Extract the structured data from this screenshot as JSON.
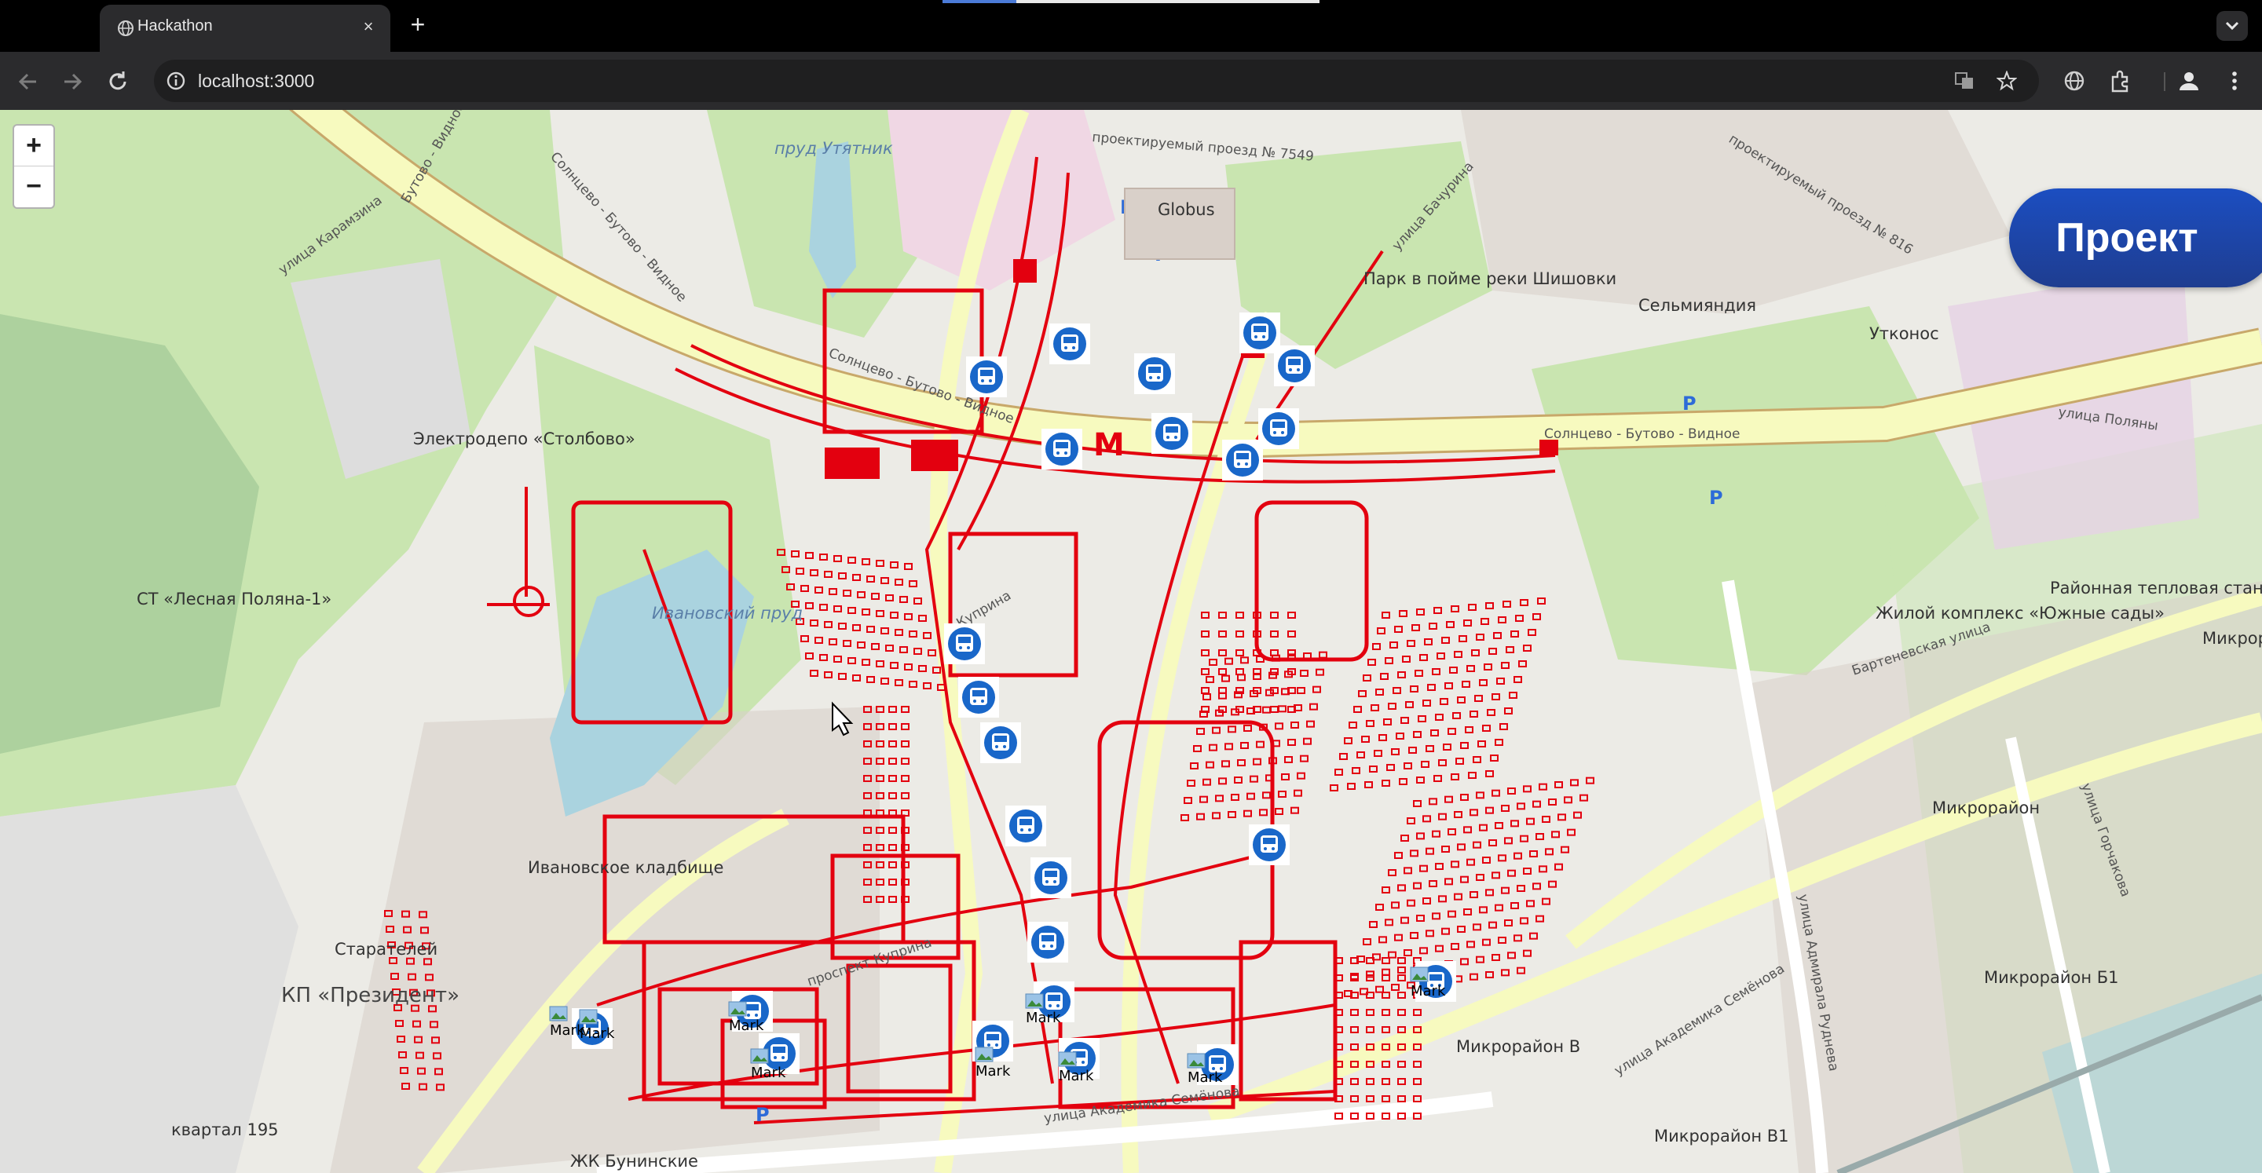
{
  "browser": {
    "tab_title": "Hackathon",
    "tab_close": "×",
    "new_tab": "+",
    "url": "localhost:3000"
  },
  "map": {
    "zoom_in": "+",
    "zoom_out": "−",
    "project_button": "Проект",
    "marker_label": "Mark",
    "labels": {
      "solntsevo_butovo_vidnoe": "Солнцево - Бутово - Видное",
      "butovo_vidnoe": "Бутово - Видное",
      "prud_utyatnik": "пруд Утятник",
      "proezd_7549": "проектируемый проезд № 7549",
      "globus": "Globus",
      "ulitsa_kupriyana": "Куприна",
      "park_shishovki": "Парк в пойме реки Шишовки",
      "ulitsa_zdanie_gruppa": "улица Бачурина",
      "selmilandiya": "Сельмияндия",
      "proezd_816": "проектируемый проезд № 816",
      "utkonos": "Утконос",
      "ulitsa_karamzina": "улица Карамзина",
      "elektrodepo": "Электродепо «Столбово»",
      "ivanovsky_prud": "Ивановский пруд",
      "st_lesnaya_polyana": "СТ «Лесная Поляна-1»",
      "ulitsa_polyany": "улица Поляны",
      "rayonnaya_stantsiya": "Районная тепловая станция «Южное Бутово»",
      "zhiloy_kompleks": "Жилой комплекс «Южные сады»",
      "bartenevskaya": "Бартеневская улица",
      "mikrorayon": "Микрорайон",
      "mikrorayon_b1": "Микрорайон Б1",
      "mikrorayon_v": "Микрорайон В",
      "mikrorayon_v1": "Микрорайон В1",
      "ivanovskoe_kladbishe": "Ивановское кладбище",
      "kp_prezident": "КП «Президент»",
      "starateley": "Старателей",
      "kvartal_195": "квартал 195",
      "zhk_buninskie": "ЖК Бунинские",
      "prospekt_kuprina": "проспект Куприна",
      "akademika_semenova": "улица Академика Семёнова",
      "admirala_rudneva": "улица Адмирала Руднева",
      "goncharova": "улица Горчакова",
      "potrigina": "улица Поляны",
      "ulitsa_kaprina_vert": "проспект Куприна",
      "mikrorayon_right": "Микрора"
    }
  },
  "colors": {
    "map_bg": "#ecebe6",
    "green": "#c9e5b0",
    "forest": "#add19e",
    "water": "#aad3df",
    "road_major": "#f7fabf",
    "road_minor": "#ffffff",
    "overlay_red": "#e3000f",
    "bus_icon_blue": "#1967c9",
    "project_blue": "#1c4ec1"
  }
}
